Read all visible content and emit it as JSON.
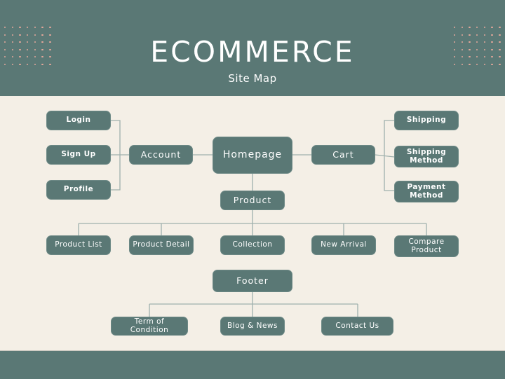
{
  "header": {
    "title": "ECOMMERCE",
    "subtitle": "Site Map"
  },
  "colors": {
    "primary": "#5a7875",
    "background": "#f4efe6",
    "connector": "#9fb0ad",
    "dot_accent": "#e4a79a",
    "text_on_node": "#ffffff"
  },
  "nodes": {
    "homepage": "Homepage",
    "account": "Account",
    "login": "Login",
    "signup": "Sign Up",
    "profile": "Profile",
    "cart": "Cart",
    "shipping": "Shipping",
    "shipping_method": "Shipping Method",
    "payment_method": "Payment Method",
    "product": "Product",
    "product_list": "Product List",
    "product_detail": "Product Detail",
    "collection": "Collection",
    "new_arrival": "New Arrival",
    "compare_product": "Compare Product",
    "footer": "Footer",
    "term_of_condition": "Term of Condition",
    "blog_news": "Blog & News",
    "contact_us": "Contact Us"
  }
}
